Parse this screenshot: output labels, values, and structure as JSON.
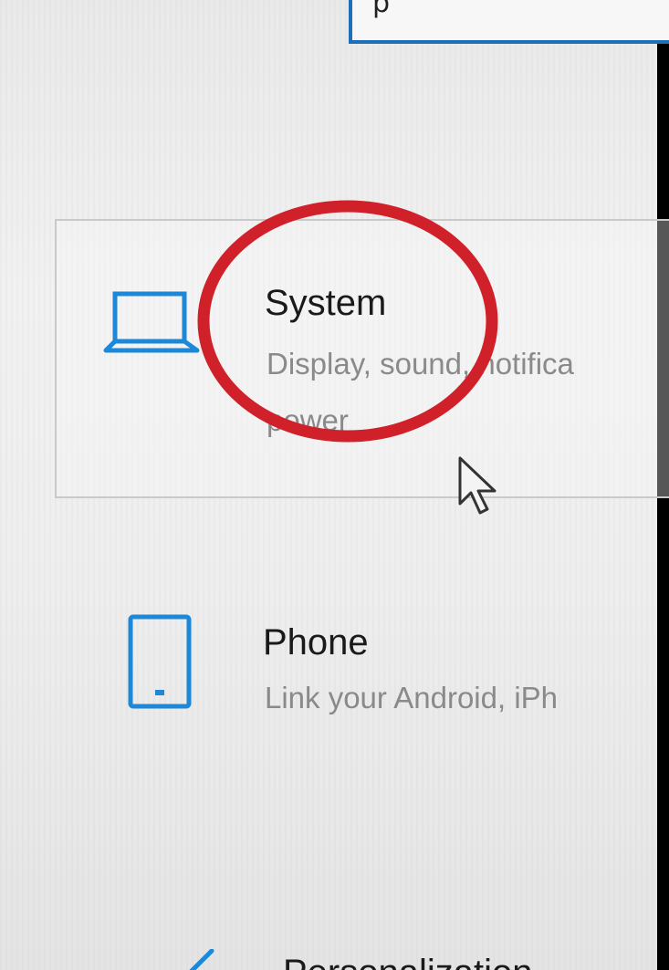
{
  "colors": {
    "accent": "#1e88d8",
    "highlight_ring": "#d0202a",
    "title_text": "#1a1a1a",
    "description_text": "#8a8a8a"
  },
  "search": {
    "value": "p"
  },
  "tiles": [
    {
      "title": "System",
      "description_line1": "Display, sound, notifica",
      "description_line2": "power",
      "icon": "laptop-icon"
    },
    {
      "title": "Phone",
      "description_line1": "Link your Android, iPh",
      "icon": "phone-icon"
    },
    {
      "title": "Personalization",
      "icon": "pen-icon"
    }
  ]
}
